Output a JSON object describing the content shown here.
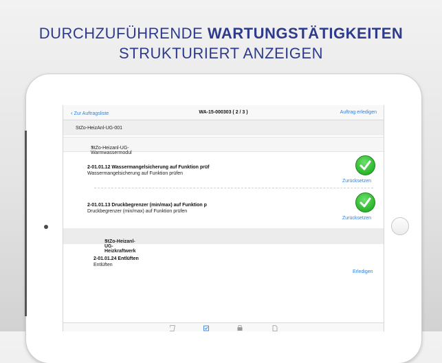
{
  "headline": {
    "line1_light": "DURCHZUFÜHRENDE",
    "line1_bold": "WARTUNGSTÄTIGKEITEN",
    "line2": "STRUKTURIERT ANZEIGEN"
  },
  "nav": {
    "back_label": "Zur Auftragsliste",
    "title": "WA-15-000303 ( 2 / 3 )",
    "action_label": "Auftrag erledigen"
  },
  "groups": {
    "level1": "StZo-HeizAnl-UG-001",
    "level2": "StZo-Heizanl-UG-Warmwassermodul",
    "level3": "StZo-Heizanl-UG-Heizkraftwerk"
  },
  "tasks": [
    {
      "title": "2-01.01.12 Wassermangelsicherung auf Funktion prüf",
      "subtitle": "Wassermangelsicherung auf Funktion prüfen",
      "action": "Zurücksetzen",
      "done": true
    },
    {
      "title": "2-01.01.13 Druckbegrenzer (min/max) auf Funktion p",
      "subtitle": "Druckbegrenzer (min/max) auf Funktion prüfen",
      "action": "Zurücksetzen",
      "done": true
    },
    {
      "title": "2-01.01.24 Entlüften",
      "subtitle": "Entlüften",
      "action": "Erledigen",
      "done": false
    }
  ],
  "colors": {
    "accent": "#2f7fe0",
    "headline": "#2e3a8c",
    "check": "#2fb92f"
  },
  "toolbar_icons": [
    "checklist-icon",
    "checkbox-icon",
    "print-icon",
    "document-icon"
  ]
}
